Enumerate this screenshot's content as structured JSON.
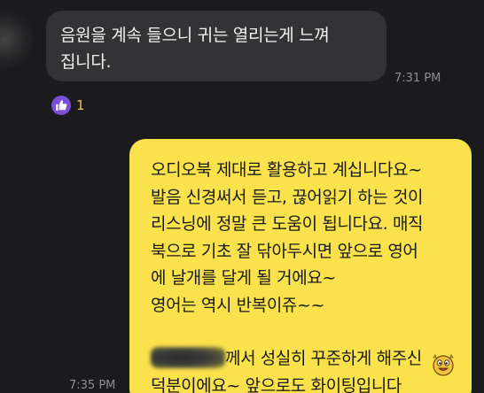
{
  "incoming": {
    "lines": [
      "음원을 계속 들으니 귀는 열리는게 느껴",
      "집니다."
    ],
    "time": "7:31 PM",
    "reaction_count": "1",
    "reaction_icon": "thumbs-up-icon"
  },
  "outgoing": {
    "lines": [
      "오디오북 제대로 활용하고 계십니다요~",
      "발음 신경써서 듣고, 끊어읽기 하는 것이",
      "리스닝에 정말 큰 도움이 됩니다요. 매직",
      "북으로 기초 잘 닦아두시면 앞으로 영어",
      "에 날개를 달게 될 거에요~",
      "영어는 역시 반복이쥬~~"
    ],
    "line7_suffix": "께서 성실히 꾸준하게 해주신",
    "line8": "덕분이에요~ 앞으로도 화이팅입니다",
    "emoji": "cheering-face-emoji",
    "time": "7:35 PM"
  },
  "colors": {
    "background": "#1b1b1d",
    "incoming_bubble": "#333335",
    "outgoing_bubble": "#f9e24b",
    "reaction": "#7b4fd6"
  }
}
